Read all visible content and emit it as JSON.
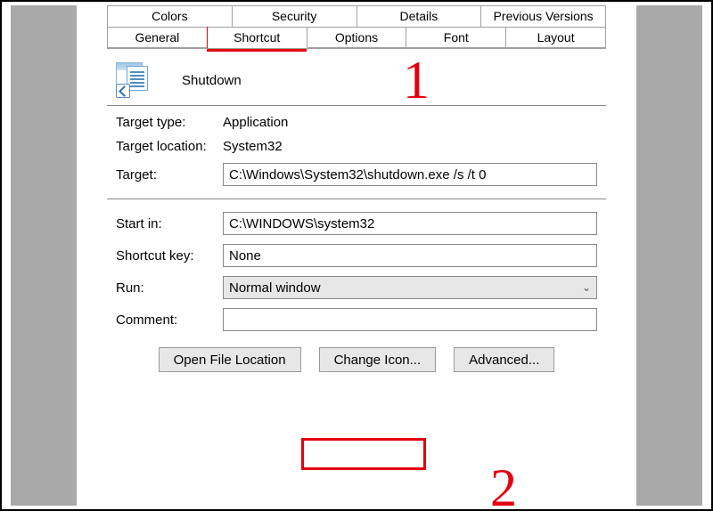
{
  "tabs": {
    "row1": [
      "Colors",
      "Security",
      "Details",
      "Previous Versions"
    ],
    "row2": [
      "General",
      "Shortcut",
      "Options",
      "Font",
      "Layout"
    ],
    "active": "Shortcut"
  },
  "shortcut": {
    "title": "Shutdown",
    "target_type_label": "Target type:",
    "target_type_value": "Application",
    "target_location_label": "Target location:",
    "target_location_value": "System32",
    "target_label": "Target:",
    "target_value": "C:\\Windows\\System32\\shutdown.exe /s /t 0",
    "start_in_label": "Start in:",
    "start_in_value": "C:\\WINDOWS\\system32",
    "shortcut_key_label": "Shortcut key:",
    "shortcut_key_value": "None",
    "run_label": "Run:",
    "run_value": "Normal window",
    "comment_label": "Comment:",
    "comment_value": ""
  },
  "buttons": {
    "open_file_location": "Open File Location",
    "change_icon": "Change Icon...",
    "advanced": "Advanced..."
  },
  "annotations": {
    "one": "1",
    "two": "2"
  }
}
